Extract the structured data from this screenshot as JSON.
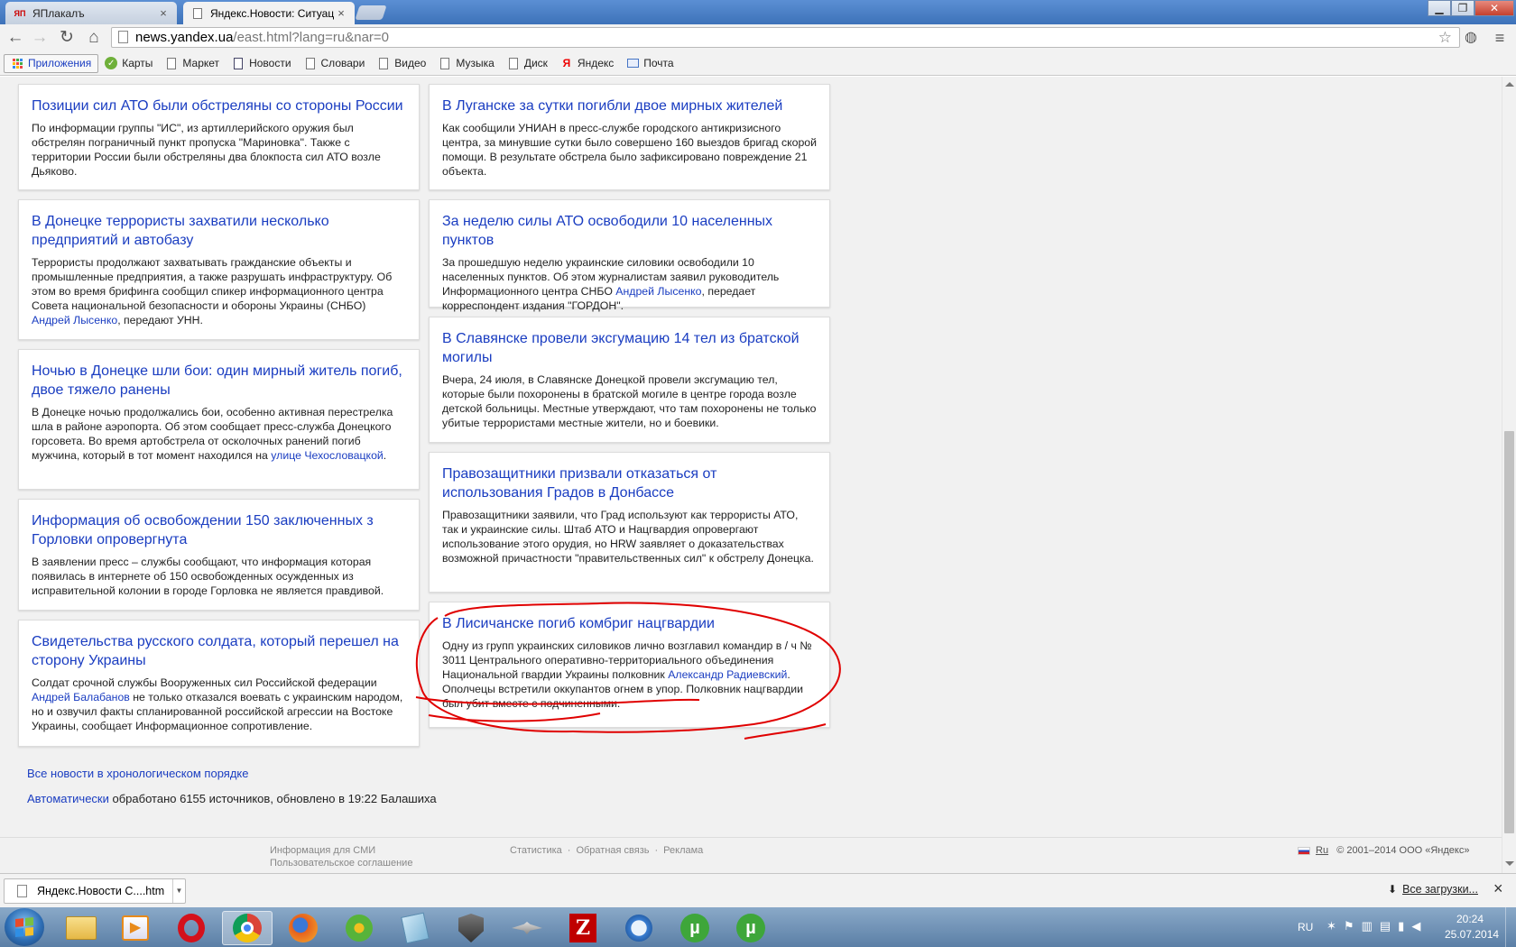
{
  "browser": {
    "tabs": [
      {
        "title": "ЯПлакалъ",
        "favicon": "ЯП",
        "active": false
      },
      {
        "title": "Яндекс.Новости: Ситуац",
        "active": true
      }
    ],
    "url_host": "news.yandex.ua",
    "url_path": "/east.html?lang=ru&nar=0",
    "bookmarks": [
      {
        "label": "Приложения",
        "icon": "apps-grid-icon"
      },
      {
        "label": "Карты",
        "icon": "maps-icon"
      },
      {
        "label": "Маркет",
        "icon": "page-icon"
      },
      {
        "label": "Новости",
        "icon": "news-icon"
      },
      {
        "label": "Словари",
        "icon": "page-icon"
      },
      {
        "label": "Видео",
        "icon": "page-icon"
      },
      {
        "label": "Музыка",
        "icon": "page-icon"
      },
      {
        "label": "Диск",
        "icon": "page-icon"
      },
      {
        "label": "Яндекс",
        "icon": "yandex-icon"
      },
      {
        "label": "Почта",
        "icon": "mail-icon"
      }
    ]
  },
  "news": {
    "left": [
      {
        "title": "Позиции сил АТО были обстреляны со стороны России",
        "text": "По информации группы \"ИС\", из артиллерийского оружия был обстрелян пограничный пункт пропуска \"Мариновка\". Также с территории России были обстреляны два блокпоста сил АТО возле Дьяково."
      },
      {
        "title": "В Донецке террористы захватили несколько предприятий и автобазу",
        "text_before": "Террористы продолжают захватывать гражданские объекты и промышленные предприятия, а также разрушать инфраструктуру. Об этом во время брифинга сообщил спикер информационного центра Совета национальной безопасности и обороны Украины (СНБО) ",
        "link": "Андрей Лысенко",
        "text_after": ", передают УНН."
      },
      {
        "title": "Ночью в Донецке шли бои: один мирный житель погиб, двое тяжело ранены",
        "text_before": "В Донецке ночью продолжались бои, особенно активная перестрелка шла в районе аэропорта. Об этом сообщает пресс-служба Донецкого горсовета. Во время артобстрела от осколочных ранений погиб мужчина, который в тот момент находился на ",
        "link": "улице Чехословацкой",
        "text_after": "."
      },
      {
        "title": "Информация об освобождении 150 заключенных з Горловки опровергнута",
        "text": "В заявлении пресс – службы сообщают, что информация которая появилась в интернете об 150 освобожденных осужденных из исправительной колонии в городе Горловка не является правдивой."
      },
      {
        "title": "Свидетельства русского солдата, который перешел на сторону Украины",
        "text_before": "Солдат срочной службы Вооруженных сил Российской федерации ",
        "link": "Андрей Балабанов",
        "text_after": " не только отказался воевать с украинским народом, но и озвучил факты спланированной российской агрессии на Востоке Украины, сообщает Информационное сопротивление."
      }
    ],
    "right": [
      {
        "title": "В Луганске за сутки погибли двое мирных жителей",
        "text": "Как сообщили УНИАН в пресс-службе городского антикризисного центра, за минувшие сутки было совершено 160 выездов бригад скорой помощи. В результате обстрела было зафиксировано повреждение 21 объекта."
      },
      {
        "title": "За неделю силы АТО освободили 10 населенных пунктов",
        "text_before": "За прошедшую неделю украинские силовики освободили 10 населенных пунктов. Об этом журналистам заявил руководитель Информационного центра СНБО ",
        "link": "Андрей Лысенко",
        "text_after": ", передает корреспондент издания \"ГОРДОН\"."
      },
      {
        "title": "В Славянске провели эксгумацию 14 тел из братской могилы",
        "text": "Вчера, 24 июля, в Славянске Донецкой провели эксгумацию тел, которые были похоронены в братской могиле в центре города возле детской больницы. Местные утверждают, что там похоронены не только убитые террористами местные жители, но и боевики."
      },
      {
        "title": "Правозащитники призвали отказаться от использования Градов в Донбассе",
        "text": "Правозащитники заявили, что Град используют как террористы АТО, так и украинские силы. Штаб АТО и Нацгвардия опровергают использование этого орудия, но HRW заявляет о доказательствах возможной причастности \"правительственных сил\" к обстрелу Донецка."
      },
      {
        "title": "В Лисичанске погиб комбриг нацгвардии",
        "text_before": "Одну из групп украинских силовиков лично возглавил командир в / ч № 3011 Центрального оперативно-территориального объединения Национальной гвардии Украины полковник ",
        "link": "Александр Радиевский",
        "text_after": ". Ополчецы встретили оккупантов огнем в упор. Полковник нацгвардии был убит вместе с подчиненными."
      }
    ],
    "all_news_link": "Все новости в хронологическом порядке",
    "auto_link": "Автоматически",
    "auto_text": " обработано 6155 источников, обновлено в 19:22 Балашиха"
  },
  "footer": {
    "media_info": "Информация для СМИ",
    "user_agreement": "Пользовательское соглашение",
    "stats": "Статистика",
    "feedback": "Обратная связь",
    "ads": "Реклама",
    "lang": "Ru",
    "copyright": "© 2001–2014  ООО «Яндекс»",
    "separator": "·"
  },
  "downloads": {
    "item": "Яндекс.Новости  С....htm",
    "all": "Все загрузки...",
    "close": "×"
  },
  "taskbar": {
    "lang": "RU",
    "time": "20:24",
    "date": "25.07.2014"
  },
  "colors": {
    "link": "#1a3dc1",
    "highlight_circle": "#e00000"
  }
}
